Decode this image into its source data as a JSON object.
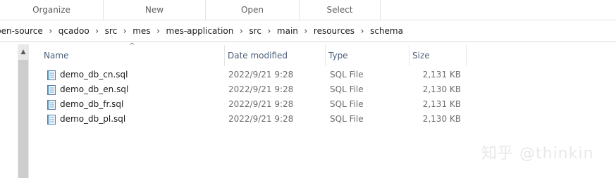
{
  "ribbon": {
    "groups": [
      "Organize",
      "New",
      "Open",
      "Select"
    ]
  },
  "address": {
    "crumbs": [
      "pen-source",
      "qcadoo",
      "src",
      "mes",
      "mes-application",
      "src",
      "main",
      "resources",
      "schema"
    ]
  },
  "columns": {
    "name": "Name",
    "date_modified": "Date modified",
    "type": "Type",
    "size": "Size"
  },
  "files": [
    {
      "name": "demo_db_cn.sql",
      "date": "2022/9/21 9:28",
      "type": "SQL File",
      "size": "2,131 KB"
    },
    {
      "name": "demo_db_en.sql",
      "date": "2022/9/21 9:28",
      "type": "SQL File",
      "size": "2,130 KB"
    },
    {
      "name": "demo_db_fr.sql",
      "date": "2022/9/21 9:28",
      "type": "SQL File",
      "size": "2,131 KB"
    },
    {
      "name": "demo_db_pl.sql",
      "date": "2022/9/21 9:28",
      "type": "SQL File",
      "size": "2,130 KB"
    }
  ],
  "icons": {
    "file": "sql-file-icon",
    "scroll_up": "scroll-up-icon",
    "sort": "sort-ascending-icon",
    "separator": "chevron-right-icon"
  },
  "watermark": "知乎 @thinkin"
}
